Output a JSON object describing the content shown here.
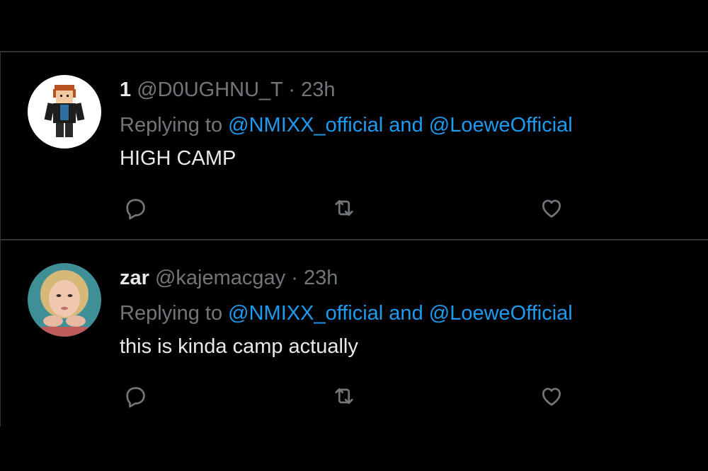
{
  "colors": {
    "background": "#000000",
    "divider": "#2f3336",
    "primary_text": "#e7e9ea",
    "secondary_text": "#71767b",
    "accent": "#1d9bf0"
  },
  "tweets": [
    {
      "display_name": "1",
      "handle": "@D0UGHNU_T",
      "separator": " · ",
      "time": "23h",
      "replying_prefix": "Replying to ",
      "mention_1": "@NMIXX_official",
      "mention_joiner": " and ",
      "mention_2": "@LoeweOfficial",
      "text": "HIGH CAMP",
      "icons": {
        "reply": "reply-icon",
        "retweet": "retweet-icon",
        "like": "heart-icon"
      }
    },
    {
      "display_name": "zar",
      "handle": "@kajemacgay",
      "separator": " · ",
      "time": "23h",
      "replying_prefix": "Replying to ",
      "mention_1": "@NMIXX_official",
      "mention_joiner": " and ",
      "mention_2": "@LoeweOfficial",
      "text": "this is kinda camp actually",
      "icons": {
        "reply": "reply-icon",
        "retweet": "retweet-icon",
        "like": "heart-icon"
      }
    }
  ]
}
